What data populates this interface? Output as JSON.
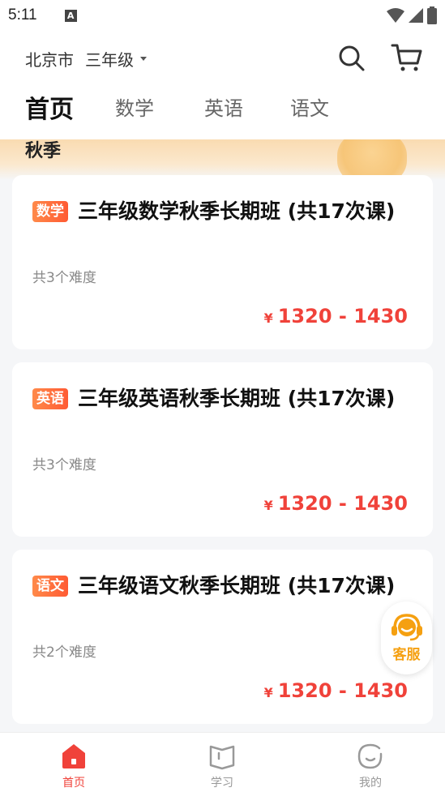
{
  "status_bar": {
    "time": "5:11",
    "notification_letter": "A"
  },
  "header": {
    "city": "北京市",
    "grade": "三年级"
  },
  "tabs": [
    {
      "label": "首页",
      "active": true
    },
    {
      "label": "数学",
      "active": false
    },
    {
      "label": "英语",
      "active": false
    },
    {
      "label": "语文",
      "active": false
    }
  ],
  "banner": {
    "title": "秋季"
  },
  "courses": [
    {
      "tag": "数学",
      "title": "三年级数学秋季长期班 (共17次课)",
      "subtitle": "共3个难度",
      "currency": "¥",
      "price": "1320 - 1430"
    },
    {
      "tag": "英语",
      "title": "三年级英语秋季长期班 (共17次课)",
      "subtitle": "共3个难度",
      "currency": "¥",
      "price": "1320 - 1430"
    },
    {
      "tag": "语文",
      "title": "三年级语文秋季长期班 (共17次课)",
      "subtitle": "共2个难度",
      "currency": "¥",
      "price": "1320 - 1430"
    }
  ],
  "service": {
    "label": "客服"
  },
  "bottom_nav": [
    {
      "label": "首页",
      "icon": "home-icon",
      "active": true
    },
    {
      "label": "学习",
      "icon": "book-icon",
      "active": false
    },
    {
      "label": "我的",
      "icon": "profile-icon",
      "active": false
    }
  ],
  "colors": {
    "accent_red": "#f0423a",
    "tag_orange": "#ff6a3d",
    "service_orange": "#f5a011"
  }
}
